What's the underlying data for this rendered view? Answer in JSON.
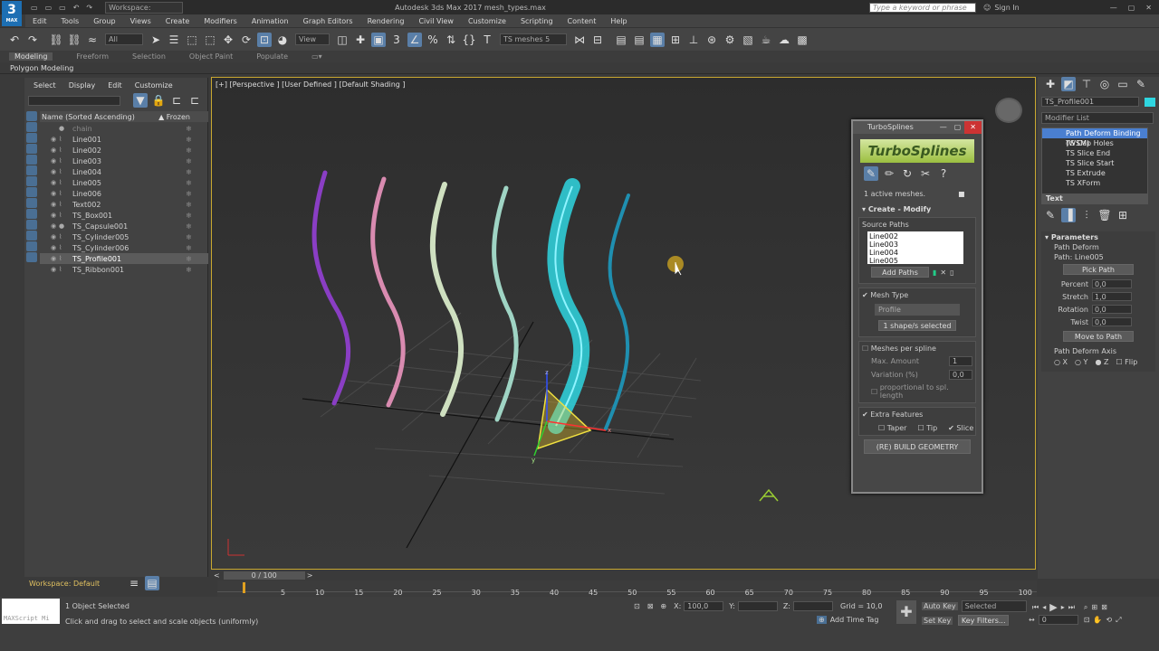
{
  "app": {
    "title": "Autodesk 3ds Max 2017    mesh_types.max",
    "workspace": "Workspace: Default",
    "search_placeholder": "Type a keyword or phrase",
    "signin": "Sign In",
    "logo": "3",
    "logo_sub": "MAX"
  },
  "menu": [
    "Edit",
    "Tools",
    "Group",
    "Views",
    "Create",
    "Modifiers",
    "Animation",
    "Graph Editors",
    "Rendering",
    "Civil View",
    "Customize",
    "Scripting",
    "Content",
    "Help"
  ],
  "toolbar": {
    "filter": "All",
    "view": "View",
    "selection_set": "TS meshes 5"
  },
  "ribbon": {
    "tabs": [
      "Modeling",
      "Freeform",
      "Selection",
      "Object Paint",
      "Populate"
    ],
    "sub": "Polygon Modeling"
  },
  "explorer": {
    "tabs": [
      "Select",
      "Display",
      "Edit",
      "Customize"
    ],
    "col_name": "Name (Sorted Ascending)",
    "col_frozen": "▲ Frozen",
    "rows": [
      "chain",
      "Line001",
      "Line002",
      "Line003",
      "Line004",
      "Line005",
      "Line006",
      "Text002",
      "TS_Box001",
      "TS_Capsule001",
      "TS_Cylinder005",
      "TS_Cylinder006",
      "TS_Profile001",
      "TS_Ribbon001"
    ],
    "workspace": "Workspace: Default"
  },
  "viewport": {
    "label": "[+] [Perspective ] [User Defined ] [Default Shading ]",
    "gizmo_axes": {
      "z": "z",
      "x": "x",
      "y": "y"
    }
  },
  "turbo": {
    "title": "TurboSplines",
    "logo": "TurboSplines",
    "active": "1 active meshes.",
    "section": "Create - Modify",
    "source_paths": "Source Paths",
    "paths": [
      "Line002",
      "Line003",
      "Line004",
      "Line005"
    ],
    "add_paths": "Add Paths",
    "mesh_type": "Mesh Type",
    "profile": "Profile",
    "shapes_selected": "1 shape/s selected",
    "meshes_per_spline": "Meshes per spline",
    "max_amount": "Max. Amount",
    "max_amount_val": "1",
    "variation": "Variation (%)",
    "variation_val": "0,0",
    "proportional": "proportional to spl. length",
    "extra": "Extra Features",
    "taper": "Taper",
    "tip": "Tip",
    "slice": "Slice",
    "build": "(RE) BUILD GEOMETRY"
  },
  "right": {
    "object_name": "TS_Profile001",
    "modifier_list": "Modifier List",
    "modifiers": [
      "Path Deform Binding (WSM)",
      "TS Cap Holes",
      "TS Slice End",
      "TS Slice Start",
      "TS Extrude",
      "TS XForm"
    ],
    "text_item": "Text",
    "params_title": "Parameters",
    "path_deform": "Path Deform",
    "path": "Path: Line005",
    "pick_path": "Pick Path",
    "params": [
      {
        "label": "Percent",
        "value": "0,0"
      },
      {
        "label": "Stretch",
        "value": "1,0"
      },
      {
        "label": "Rotation",
        "value": "0,0"
      },
      {
        "label": "Twist",
        "value": "0,0"
      }
    ],
    "move_to_path": "Move to Path",
    "axis_title": "Path Deform Axis",
    "axes": [
      "X",
      "Y",
      "Z",
      "Flip"
    ],
    "axis_selected": "Z"
  },
  "timeline": {
    "counter": "0 / 100",
    "ticks": [
      "5",
      "10",
      "15",
      "20",
      "25",
      "30",
      "35",
      "40",
      "45",
      "50",
      "55",
      "60",
      "65",
      "70",
      "75",
      "80",
      "85",
      "90",
      "95",
      "100"
    ]
  },
  "status": {
    "selected": "1 Object Selected",
    "hint": "Click and drag to select and scale objects (uniformly)",
    "x_label": "X:",
    "x": "100,0",
    "y_label": "Y:",
    "z_label": "Z:",
    "grid": "Grid = 10,0",
    "add_time_tag": "Add Time Tag",
    "auto_key": "Auto Key",
    "set_key": "Set Key",
    "selected_mode": "Selected",
    "key_filters": "Key Filters...",
    "frame": "0",
    "maxscript": "MAXScript Mi"
  },
  "colors": {
    "accent": "#4a7fd0",
    "viewport_border": "#c9a830",
    "cyan": "#2fd6e0"
  }
}
